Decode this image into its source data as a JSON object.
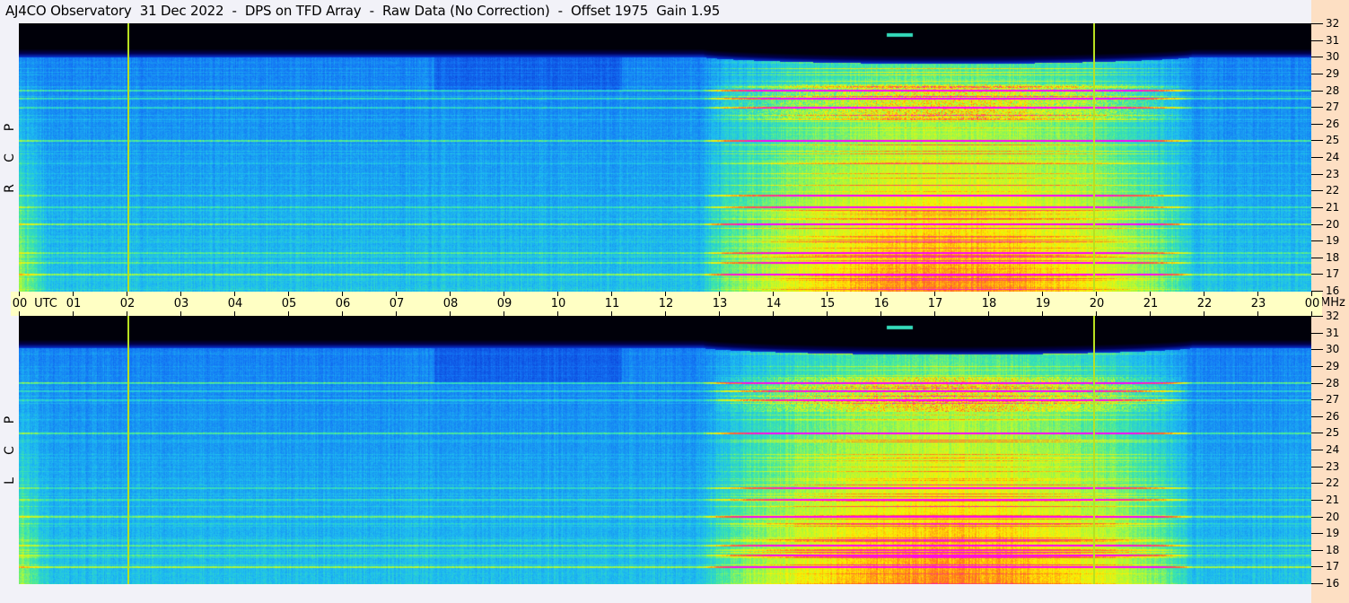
{
  "title": "AJ4CO Observatory  31 Dec 2022  -  DPS on TFD Array  -  Raw Data (No Correction)  -  Offset 1975  Gain 1.95",
  "panels": [
    {
      "id": "rcp",
      "letters": [
        "R",
        "C",
        "P"
      ]
    },
    {
      "id": "lcp",
      "letters": [
        "L",
        "C",
        "P"
      ]
    }
  ],
  "chart_data": {
    "type": "heatmap",
    "title": "AJ4CO Observatory  31 Dec 2022  -  DPS on TFD Array  -  Raw Data (No Correction)  -  Offset 1975  Gain 1.95",
    "xlabel": "UTC",
    "ylabel": "MHz",
    "x_range_hours": [
      0,
      24
    ],
    "y_range_mhz": [
      16,
      32
    ],
    "x_ticks": [
      "00",
      "01",
      "02",
      "03",
      "04",
      "05",
      "06",
      "07",
      "08",
      "09",
      "10",
      "11",
      "12",
      "13",
      "14",
      "15",
      "16",
      "17",
      "18",
      "19",
      "20",
      "21",
      "22",
      "23",
      "00"
    ],
    "y_ticks": [
      "32",
      "31",
      "30",
      "29",
      "28",
      "27",
      "26",
      "25",
      "24",
      "23",
      "22",
      "21",
      "20",
      "19",
      "18",
      "17",
      "16"
    ],
    "x_unit_label": "UTC",
    "y_unit_label": "MHz",
    "marker_lines_hours": [
      2.03,
      19.97
    ],
    "rfi_bands_mhz": [
      17.0,
      17.7,
      18.3,
      20.0,
      21.0,
      21.7,
      25.0,
      27.0,
      27.5,
      28.0
    ],
    "daytime_hours": [
      12.7,
      23.6
    ],
    "colors": {
      "marker": "#b8e020",
      "timebar": "#ffffc4",
      "axis_bg": "#fddfc3"
    }
  }
}
